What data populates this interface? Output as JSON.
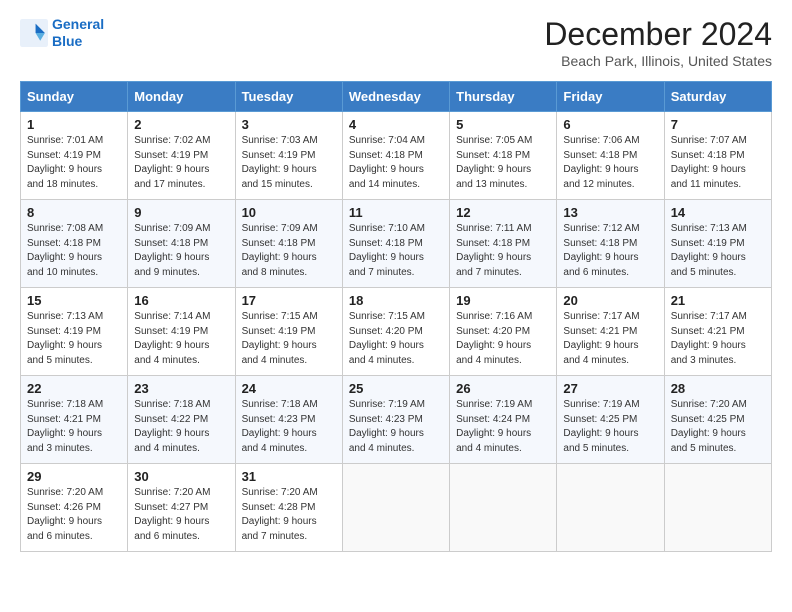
{
  "header": {
    "logo_line1": "General",
    "logo_line2": "Blue",
    "month_title": "December 2024",
    "location": "Beach Park, Illinois, United States"
  },
  "days_of_week": [
    "Sunday",
    "Monday",
    "Tuesday",
    "Wednesday",
    "Thursday",
    "Friday",
    "Saturday"
  ],
  "weeks": [
    [
      {
        "day": "1",
        "sunrise": "7:01 AM",
        "sunset": "4:19 PM",
        "daylight": "9 hours and 18 minutes."
      },
      {
        "day": "2",
        "sunrise": "7:02 AM",
        "sunset": "4:19 PM",
        "daylight": "9 hours and 17 minutes."
      },
      {
        "day": "3",
        "sunrise": "7:03 AM",
        "sunset": "4:19 PM",
        "daylight": "9 hours and 15 minutes."
      },
      {
        "day": "4",
        "sunrise": "7:04 AM",
        "sunset": "4:18 PM",
        "daylight": "9 hours and 14 minutes."
      },
      {
        "day": "5",
        "sunrise": "7:05 AM",
        "sunset": "4:18 PM",
        "daylight": "9 hours and 13 minutes."
      },
      {
        "day": "6",
        "sunrise": "7:06 AM",
        "sunset": "4:18 PM",
        "daylight": "9 hours and 12 minutes."
      },
      {
        "day": "7",
        "sunrise": "7:07 AM",
        "sunset": "4:18 PM",
        "daylight": "9 hours and 11 minutes."
      }
    ],
    [
      {
        "day": "8",
        "sunrise": "7:08 AM",
        "sunset": "4:18 PM",
        "daylight": "9 hours and 10 minutes."
      },
      {
        "day": "9",
        "sunrise": "7:09 AM",
        "sunset": "4:18 PM",
        "daylight": "9 hours and 9 minutes."
      },
      {
        "day": "10",
        "sunrise": "7:09 AM",
        "sunset": "4:18 PM",
        "daylight": "9 hours and 8 minutes."
      },
      {
        "day": "11",
        "sunrise": "7:10 AM",
        "sunset": "4:18 PM",
        "daylight": "9 hours and 7 minutes."
      },
      {
        "day": "12",
        "sunrise": "7:11 AM",
        "sunset": "4:18 PM",
        "daylight": "9 hours and 7 minutes."
      },
      {
        "day": "13",
        "sunrise": "7:12 AM",
        "sunset": "4:18 PM",
        "daylight": "9 hours and 6 minutes."
      },
      {
        "day": "14",
        "sunrise": "7:13 AM",
        "sunset": "4:19 PM",
        "daylight": "9 hours and 5 minutes."
      }
    ],
    [
      {
        "day": "15",
        "sunrise": "7:13 AM",
        "sunset": "4:19 PM",
        "daylight": "9 hours and 5 minutes."
      },
      {
        "day": "16",
        "sunrise": "7:14 AM",
        "sunset": "4:19 PM",
        "daylight": "9 hours and 4 minutes."
      },
      {
        "day": "17",
        "sunrise": "7:15 AM",
        "sunset": "4:19 PM",
        "daylight": "9 hours and 4 minutes."
      },
      {
        "day": "18",
        "sunrise": "7:15 AM",
        "sunset": "4:20 PM",
        "daylight": "9 hours and 4 minutes."
      },
      {
        "day": "19",
        "sunrise": "7:16 AM",
        "sunset": "4:20 PM",
        "daylight": "9 hours and 4 minutes."
      },
      {
        "day": "20",
        "sunrise": "7:17 AM",
        "sunset": "4:21 PM",
        "daylight": "9 hours and 4 minutes."
      },
      {
        "day": "21",
        "sunrise": "7:17 AM",
        "sunset": "4:21 PM",
        "daylight": "9 hours and 3 minutes."
      }
    ],
    [
      {
        "day": "22",
        "sunrise": "7:18 AM",
        "sunset": "4:21 PM",
        "daylight": "9 hours and 3 minutes."
      },
      {
        "day": "23",
        "sunrise": "7:18 AM",
        "sunset": "4:22 PM",
        "daylight": "9 hours and 4 minutes."
      },
      {
        "day": "24",
        "sunrise": "7:18 AM",
        "sunset": "4:23 PM",
        "daylight": "9 hours and 4 minutes."
      },
      {
        "day": "25",
        "sunrise": "7:19 AM",
        "sunset": "4:23 PM",
        "daylight": "9 hours and 4 minutes."
      },
      {
        "day": "26",
        "sunrise": "7:19 AM",
        "sunset": "4:24 PM",
        "daylight": "9 hours and 4 minutes."
      },
      {
        "day": "27",
        "sunrise": "7:19 AM",
        "sunset": "4:25 PM",
        "daylight": "9 hours and 5 minutes."
      },
      {
        "day": "28",
        "sunrise": "7:20 AM",
        "sunset": "4:25 PM",
        "daylight": "9 hours and 5 minutes."
      }
    ],
    [
      {
        "day": "29",
        "sunrise": "7:20 AM",
        "sunset": "4:26 PM",
        "daylight": "9 hours and 6 minutes."
      },
      {
        "day": "30",
        "sunrise": "7:20 AM",
        "sunset": "4:27 PM",
        "daylight": "9 hours and 6 minutes."
      },
      {
        "day": "31",
        "sunrise": "7:20 AM",
        "sunset": "4:28 PM",
        "daylight": "9 hours and 7 minutes."
      },
      null,
      null,
      null,
      null
    ]
  ]
}
